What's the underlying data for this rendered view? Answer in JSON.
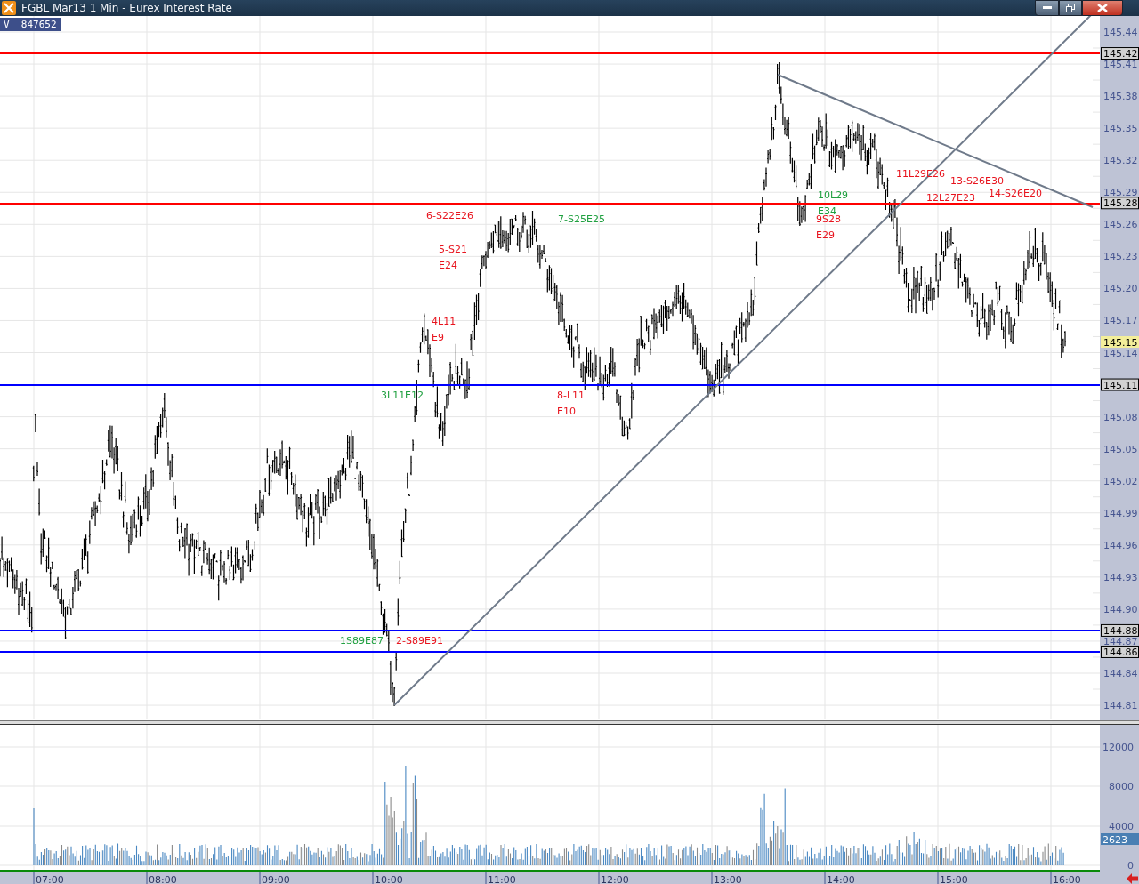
{
  "window": {
    "title": "FGBL Mar13 1 Min - Eurex Interest Rate"
  },
  "volume_badge": {
    "text": "V  847652"
  },
  "price_axis": {
    "ticks": [
      "145.44",
      "145.41",
      "145.38",
      "145.35",
      "145.32",
      "145.29",
      "145.26",
      "145.23",
      "145.20",
      "145.17",
      "145.14",
      "145.08",
      "145.05",
      "145.02",
      "144.99",
      "144.96",
      "144.93",
      "144.90",
      "144.87",
      "144.84",
      "144.81"
    ]
  },
  "price_levels": [
    {
      "label": "145.42",
      "color": "#ff0000"
    },
    {
      "label": "145.28",
      "color": "#ff0000"
    },
    {
      "label": "145.11",
      "color": "#0000ff"
    },
    {
      "label": "144.88",
      "color": "#0000ff"
    },
    {
      "label": "144.86",
      "color": "#0000ff"
    }
  ],
  "last_price": "145.15",
  "annotations": [
    {
      "text": "6-S22E26",
      "color": "#e8141e"
    },
    {
      "text": "5-S21",
      "color": "#e8141e"
    },
    {
      "text": "E24",
      "color": "#e8141e"
    },
    {
      "text": "7-S25E25",
      "color": "#20a040"
    },
    {
      "text": "4L11",
      "color": "#e8141e"
    },
    {
      "text": "E9",
      "color": "#e8141e"
    },
    {
      "text": "3L11E12",
      "color": "#20a040"
    },
    {
      "text": "8-L11",
      "color": "#e8141e"
    },
    {
      "text": "E10",
      "color": "#e8141e"
    },
    {
      "text": "1S89E87",
      "color": "#20a040"
    },
    {
      "text": "2-S89E91",
      "color": "#e8141e"
    },
    {
      "text": "10L29",
      "color": "#20a040"
    },
    {
      "text": "E34",
      "color": "#20a040"
    },
    {
      "text": "9S28",
      "color": "#e8141e"
    },
    {
      "text": "E29",
      "color": "#e8141e"
    },
    {
      "text": "11L29E26",
      "color": "#e8141e"
    },
    {
      "text": "13-S26E30",
      "color": "#e8141e"
    },
    {
      "text": "12L27E23",
      "color": "#e8141e"
    },
    {
      "text": "14-S26E20",
      "color": "#e8141e"
    }
  ],
  "volume_axis": {
    "ticks": [
      "12000",
      "8000",
      "4000",
      "0"
    ],
    "last_volume": "2623"
  },
  "time_axis": {
    "labels": [
      "07:00",
      "08:00",
      "09:00",
      "10:00",
      "11:00",
      "12:00",
      "13:00",
      "14:00",
      "15:00",
      "16:00"
    ]
  }
}
